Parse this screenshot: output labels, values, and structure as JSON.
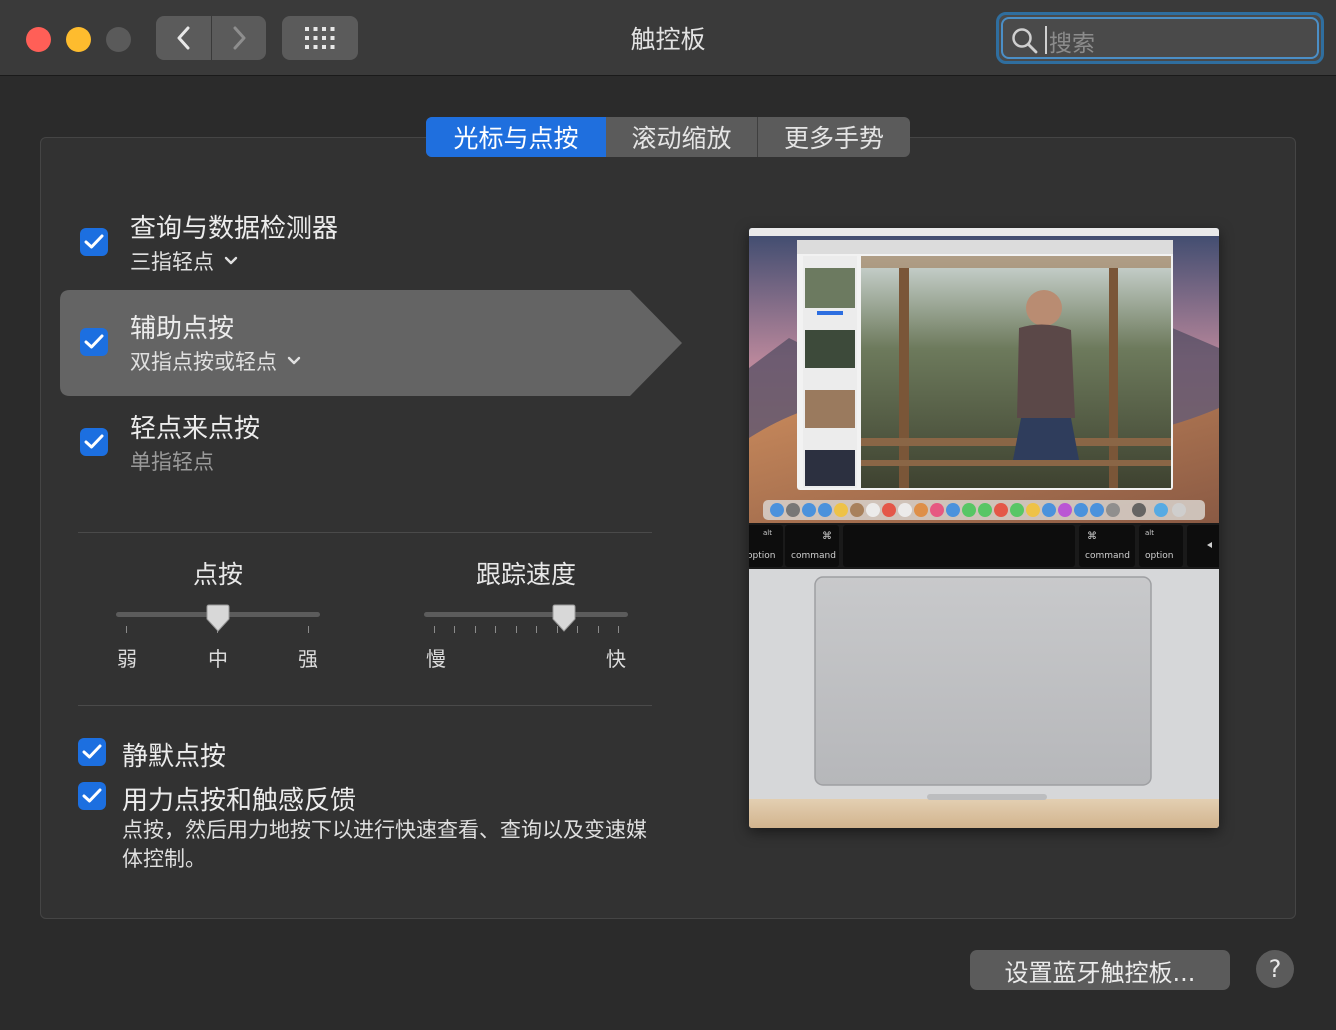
{
  "window": {
    "title": "触控板",
    "search_placeholder": "搜索"
  },
  "tabs": [
    {
      "label": "光标与点按",
      "selected": true
    },
    {
      "label": "滚动缩放",
      "selected": false
    },
    {
      "label": "更多手势",
      "selected": false
    }
  ],
  "options": [
    {
      "title": "查询与数据检测器",
      "subtitle": "三指轻点",
      "checked": true,
      "has_menu": true
    },
    {
      "title": "辅助点按",
      "subtitle": "双指点按或轻点",
      "checked": true,
      "has_menu": true
    },
    {
      "title": "轻点来点按",
      "subtitle": "单指轻点",
      "checked": true,
      "has_menu": false
    }
  ],
  "sliders": {
    "click": {
      "title": "点按",
      "labels": [
        "弱",
        "中",
        "强"
      ],
      "value": "中"
    },
    "tracking": {
      "title": "跟踪速度",
      "min_label": "慢",
      "max_label": "快",
      "value_fraction": 0.7
    }
  },
  "bottom_options": [
    {
      "label": "静默点按",
      "checked": true
    },
    {
      "label": "用力点按和触感反馈",
      "checked": true
    }
  ],
  "force_click_description": "点按，然后用力地按下以进行快速查看、查询以及变速媒体控制。",
  "preview": {
    "keys": [
      "alt",
      "option",
      "⌘",
      "command",
      "⌘",
      "command",
      "alt",
      "option"
    ]
  },
  "footer": {
    "bluetooth_button": "设置蓝牙触控板...",
    "help_label": "?"
  },
  "colors": {
    "accent": "#1f6fde",
    "window_bg": "#2b2b2b",
    "panel_bg": "#323232",
    "selected_row": "#646464"
  }
}
